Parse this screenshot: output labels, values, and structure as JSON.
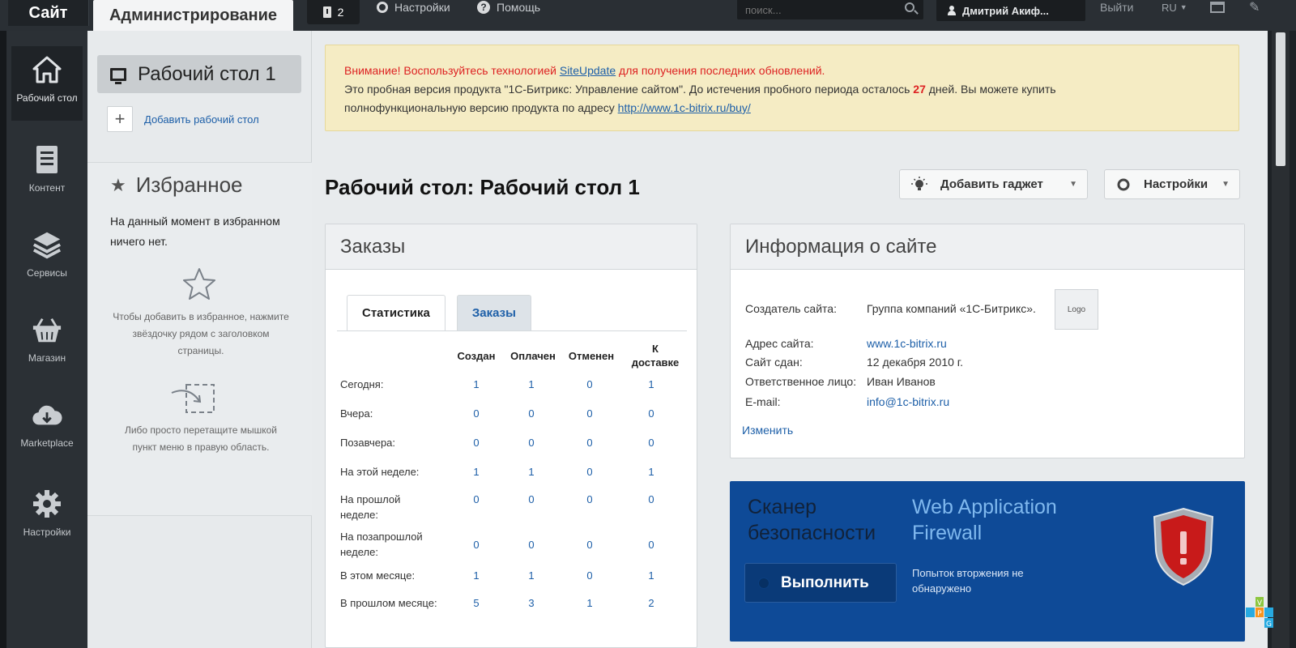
{
  "topbar": {
    "site_tab": "Сайт",
    "admin_tab": "Администрирование",
    "notifications_count": "2",
    "settings_label": "Настройки",
    "help_label": "Помощь",
    "search_placeholder": "поиск...",
    "user_name": "Дмитрий Акиф...",
    "logout_label": "Выйти",
    "language": "RU"
  },
  "leftnav": {
    "items": [
      {
        "label": "Рабочий стол",
        "icon": "home-icon"
      },
      {
        "label": "Контент",
        "icon": "document-icon"
      },
      {
        "label": "Сервисы",
        "icon": "layers-icon"
      },
      {
        "label": "Магазин",
        "icon": "basket-icon"
      },
      {
        "label": "Marketplace",
        "icon": "cloud-download-icon"
      },
      {
        "label": "Настройки",
        "icon": "gear-icon"
      }
    ]
  },
  "sidebar": {
    "desktop_label": "Рабочий стол 1",
    "add_desktop_label": "Добавить рабочий стол",
    "favorites_title": "Избранное",
    "favorites_empty": "На данный момент в избранном ничего нет.",
    "favorites_hint_star": "Чтобы добавить в избранное, нажмите звёздочку рядом с заголовком страницы.",
    "favorites_hint_drag": "Либо просто перетащите мышкой пункт меню в правую область."
  },
  "notice": {
    "warning": "Внимание! Воспользуйтесь технологией",
    "siteupdate_link": "SiteUpdate",
    "warning_tail": "для получения последних обновлений.",
    "trial_text": "Это пробная версия продукта \"1С-Битрикс: Управление сайтом\". До истечения пробного периода осталось",
    "days_left": "27",
    "trial_text_tail": "дней. Вы можете купить",
    "buy_text": "полнофункциональную версию продукта по адресу",
    "buy_link": "http://www.1c-bitrix.ru/buy/"
  },
  "main": {
    "page_title": "Рабочий стол: Рабочий стол 1",
    "add_gadget_label": "Добавить гаджет",
    "settings_label": "Настройки"
  },
  "orders": {
    "title": "Заказы",
    "tabs": [
      "Статистика",
      "Заказы"
    ],
    "columns": [
      "Создан",
      "Оплачен",
      "Отменен",
      "К доставке"
    ],
    "rows": [
      {
        "label": "Сегодня:",
        "values": [
          "1",
          "1",
          "0",
          "1"
        ]
      },
      {
        "label": "Вчера:",
        "values": [
          "0",
          "0",
          "0",
          "0"
        ]
      },
      {
        "label": "Позавчера:",
        "values": [
          "0",
          "0",
          "0",
          "0"
        ]
      },
      {
        "label": "На этой неделе:",
        "values": [
          "1",
          "1",
          "0",
          "1"
        ]
      },
      {
        "label": "На прошлой неделе:",
        "values": [
          "0",
          "0",
          "0",
          "0"
        ]
      },
      {
        "label": "На позапрошлой неделе:",
        "values": [
          "0",
          "0",
          "0",
          "0"
        ]
      },
      {
        "label": "В этом месяце:",
        "values": [
          "1",
          "1",
          "0",
          "1"
        ]
      },
      {
        "label": "В прошлом месяце:",
        "values": [
          "5",
          "3",
          "1",
          "2"
        ]
      }
    ]
  },
  "site_info": {
    "title": "Информация о сайте",
    "creator_label": "Создатель сайта:",
    "creator_value": "Группа компаний «1С-Битрикс».",
    "logo_text": "Logo",
    "address_label": "Адрес сайта:",
    "address_value": "www.1c-bitrix.ru",
    "delivered_label": "Сайт сдан:",
    "delivered_value": "12 декабря 2010 г.",
    "responsible_label": "Ответственное лицо:",
    "responsible_value": "Иван Иванов",
    "email_label": "E-mail:",
    "email_value": "info@1c-bitrix.ru",
    "edit_label": "Изменить"
  },
  "scanner": {
    "title": "Сканер безопасности",
    "waf_title": "Web Application Firewall",
    "run_label": "Выполнить",
    "result_text": "Попыток вторжения не обнаружено"
  },
  "watermark": {
    "text": "VPG"
  },
  "colors": {
    "topbar": "#2a2f34",
    "link": "#1d5fa8",
    "warning": "#dd2222",
    "scanner_bg": "#0e4a97"
  }
}
